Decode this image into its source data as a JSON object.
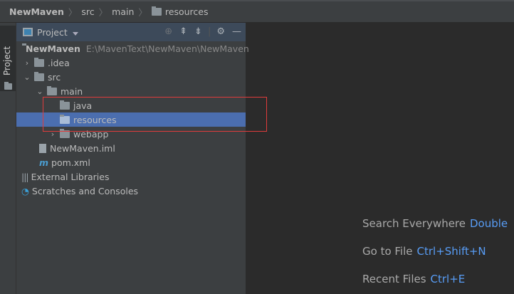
{
  "breadcrumb": [
    "NewMaven",
    "src",
    "main",
    "resources"
  ],
  "sidebar_tab": "Project",
  "panel": {
    "title": "Project",
    "tools": [
      "locate-icon",
      "expand-all-icon",
      "collapse-all-icon",
      "gear-icon",
      "minimize-icon"
    ]
  },
  "tree": [
    {
      "label": "NewMaven",
      "path": "E:\\MavenText\\NewMaven\\NewMaven",
      "depth": 0,
      "icon": "module-folder",
      "bold": true
    },
    {
      "label": ".idea",
      "depth": 1,
      "icon": "folder",
      "arrow": "right"
    },
    {
      "label": "src",
      "depth": 1,
      "icon": "folder",
      "arrow": "down"
    },
    {
      "label": "main",
      "depth": 2,
      "icon": "folder",
      "arrow": "down"
    },
    {
      "label": "java",
      "depth": 3,
      "icon": "folder"
    },
    {
      "label": "resources",
      "depth": 3,
      "icon": "folder",
      "selected": true
    },
    {
      "label": "webapp",
      "depth": 3,
      "icon": "folder",
      "arrow": "right"
    },
    {
      "label": "NewMaven.iml",
      "depth": 2,
      "icon": "file"
    },
    {
      "label": "pom.xml",
      "depth": 2,
      "icon": "maven"
    },
    {
      "label": "External Libraries",
      "depth": 0,
      "icon": "libraries"
    },
    {
      "label": "Scratches and Consoles",
      "depth": 0,
      "icon": "scratches"
    }
  ],
  "hints": [
    {
      "label": "Search Everywhere",
      "key": "Double"
    },
    {
      "label": "Go to File",
      "key": "Ctrl+Shift+N"
    },
    {
      "label": "Recent Files",
      "key": "Ctrl+E"
    }
  ],
  "colors": {
    "selection": "#4b6eaf",
    "accent": "#589df6",
    "highlight_box": "#e03c3c"
  }
}
